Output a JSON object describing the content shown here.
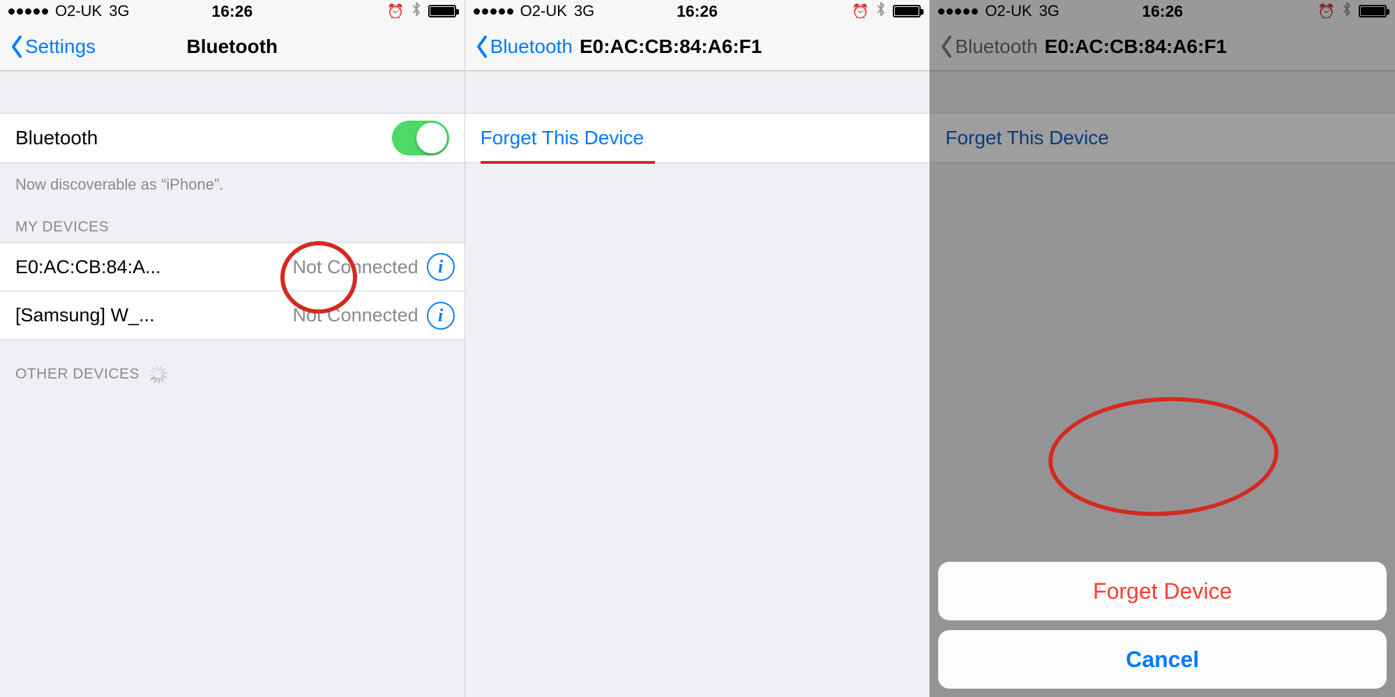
{
  "statusbar": {
    "carrier": "O2-UK",
    "network": "3G",
    "time": "16:26",
    "alarm_icon": "⏰",
    "bt_icon": "bluetooth"
  },
  "pane1": {
    "back_label": "Settings",
    "title": "Bluetooth",
    "bt_label": "Bluetooth",
    "discoverable": "Now discoverable as “iPhone”.",
    "my_devices_header": "MY DEVICES",
    "other_devices_header": "OTHER DEVICES",
    "devices": [
      {
        "name": "E0:AC:CB:84:A...",
        "status": "Not Connected"
      },
      {
        "name": "[Samsung] W_...",
        "status": "Not Connected"
      }
    ]
  },
  "pane2": {
    "back_label": "Bluetooth",
    "title": "E0:AC:CB:84:A6:F1",
    "forget_label": "Forget This Device"
  },
  "pane3": {
    "back_label": "Bluetooth",
    "title": "E0:AC:CB:84:A6:F1",
    "forget_label": "Forget This Device",
    "actionsheet": {
      "destructive": "Forget Device",
      "cancel": "Cancel"
    }
  }
}
